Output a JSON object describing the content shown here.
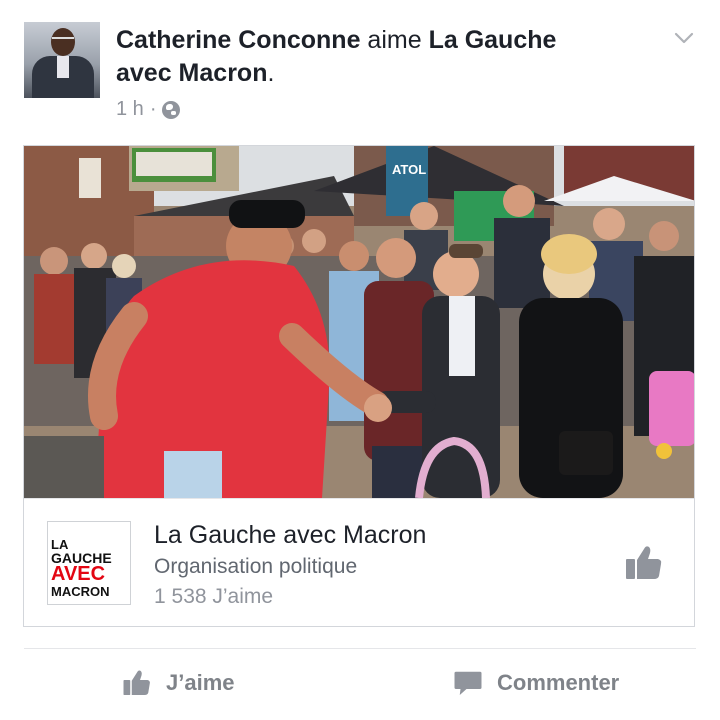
{
  "story": {
    "actor": "Catherine Conconne",
    "verb": " aime ",
    "page_name": "La Gauche avec Macron",
    "period": ".",
    "time": "1 h",
    "separator": "·"
  },
  "card": {
    "logo_lines": [
      "LA",
      "GAUCHE",
      "AVEC",
      "MACRON"
    ],
    "page_name": "La Gauche avec Macron",
    "category": "Organisation politique",
    "likes": "1 538 J’aime",
    "photo_signs": [
      "ATOL"
    ]
  },
  "actions": {
    "like": "J’aime",
    "comment": "Commenter"
  },
  "icons": [
    "chevron-down-icon",
    "globe-icon",
    "thumbs-up-icon",
    "comment-icon"
  ],
  "colors": {
    "text": "#1d2129",
    "muted": "#90949c",
    "logo_red": "#e30613",
    "icon_gray": "#90949c"
  }
}
